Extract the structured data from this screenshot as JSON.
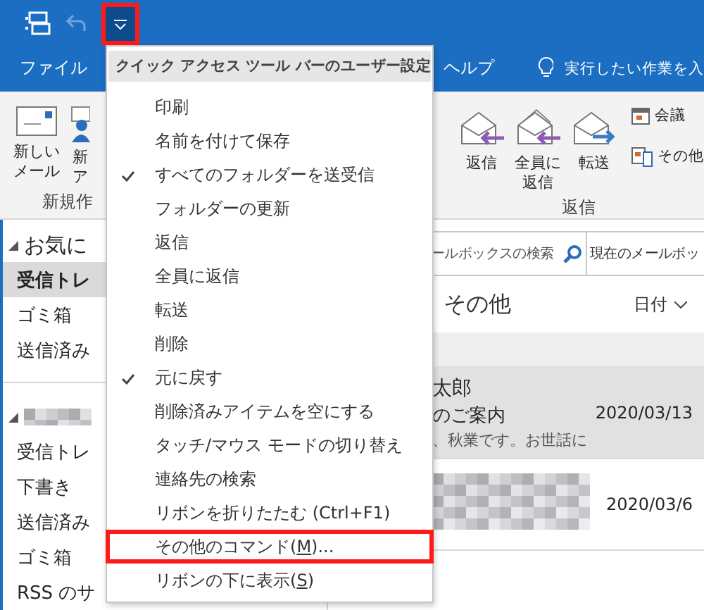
{
  "quick_access": {
    "customize_button": {
      "pressed": true,
      "highlighted": true
    }
  },
  "ribbon_tabs": [
    {
      "label": "ファイル",
      "kind": "tab"
    },
    {
      "label": "ヘルプ",
      "kind": "tab"
    },
    {
      "label": "実行したい作業を入",
      "kind": "tellme"
    }
  ],
  "ribbon": {
    "new_group": {
      "buttons": [
        {
          "lines": [
            "新しい",
            "メール"
          ],
          "kind": "mail"
        },
        {
          "lines": [
            "新",
            "ア"
          ],
          "kind": "item"
        }
      ],
      "label": "新規作"
    },
    "respond_group": {
      "buttons": [
        {
          "lines": [
            "返信"
          ],
          "kind": "reply"
        },
        {
          "lines": [
            "全員に",
            "返信"
          ],
          "kind": "replyall"
        },
        {
          "lines": [
            "転送"
          ],
          "kind": "forward"
        }
      ],
      "small_buttons": [
        {
          "label": "会議",
          "kind": "meeting"
        },
        {
          "label": "その他",
          "kind": "more"
        }
      ],
      "label": "返信"
    }
  },
  "folder_pane": {
    "sections": [
      {
        "title": "お気に",
        "redacted": false,
        "folders": [
          {
            "label": "受信トレ",
            "selected": true
          },
          {
            "label": "ゴミ箱",
            "selected": false
          },
          {
            "label": "送信済み",
            "selected": false
          }
        ]
      },
      {
        "redacted": true,
        "folders": [
          {
            "label": "受信トレ",
            "selected": false
          },
          {
            "label": "下書き",
            "selected": false
          },
          {
            "label": "送信済み",
            "selected": false
          },
          {
            "label": "ゴミ箱",
            "selected": false
          },
          {
            "label": "RSS のサ",
            "selected": false
          }
        ]
      }
    ]
  },
  "mail_list": {
    "search": {
      "placeholder": "ールボックスの検索",
      "scope": "現在のメールボッ"
    },
    "filter": "その他",
    "sort": "日付",
    "messages": [
      {
        "sender": "太郎",
        "subject": "のご案内",
        "preview": "、秋業です。お世話に",
        "date": "2020/03/13",
        "selected": true,
        "redacted": false
      },
      {
        "date": "2020/03/6",
        "selected": false,
        "redacted": true
      }
    ]
  },
  "menu": {
    "title": "クイック アクセス ツール バーのユーザー設定",
    "items": [
      {
        "label": "印刷",
        "checked": false,
        "highlighted": false
      },
      {
        "label": "名前を付けて保存",
        "checked": false,
        "highlighted": false
      },
      {
        "label": "すべてのフォルダーを送受信",
        "checked": true,
        "highlighted": false
      },
      {
        "label": "フォルダーの更新",
        "checked": false,
        "highlighted": false
      },
      {
        "label": "返信",
        "checked": false,
        "highlighted": false
      },
      {
        "label": "全員に返信",
        "checked": false,
        "highlighted": false
      },
      {
        "label": "転送",
        "checked": false,
        "highlighted": false
      },
      {
        "label": "削除",
        "checked": false,
        "highlighted": false
      },
      {
        "label": "元に戻す",
        "checked": true,
        "highlighted": false
      },
      {
        "label": "削除済みアイテムを空にする",
        "checked": false,
        "highlighted": false
      },
      {
        "label": "タッチ/マウス モードの切り替え",
        "checked": false,
        "highlighted": false
      },
      {
        "label": "連絡先の検索",
        "checked": false,
        "highlighted": false
      },
      {
        "label": "リボンを折りたたむ (Ctrl+F1)",
        "checked": false,
        "highlighted": false
      },
      {
        "label": "その他のコマンド(",
        "access_key": "M",
        "label_after": ")...",
        "checked": false,
        "highlighted": true
      },
      {
        "label": "リボンの下に表示(",
        "access_key": "S",
        "label_after": ")",
        "checked": false,
        "highlighted": false
      }
    ]
  }
}
